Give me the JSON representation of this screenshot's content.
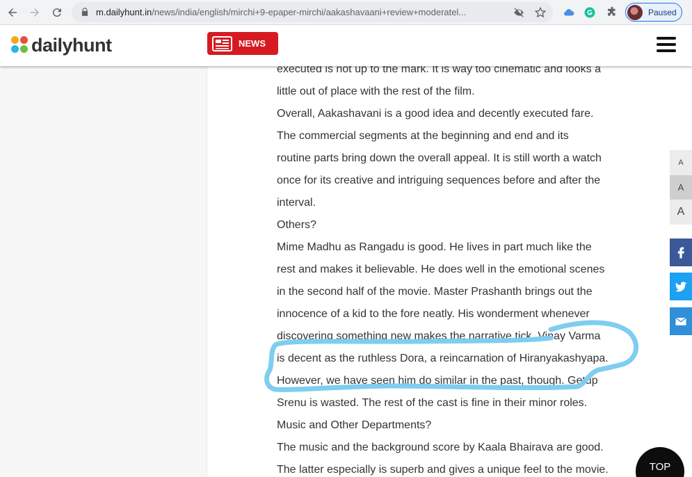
{
  "browser": {
    "url_host": "m.dailyhunt.in",
    "url_path": "/news/india/english/mirchi+9-epaper-mirchi/aakashavaani+review+moderatel...",
    "profile_label": "Paused"
  },
  "header": {
    "logo_text": "dailyhunt",
    "news_label": "NEWS"
  },
  "article": {
    "paragraphs": [
      "executed is not up to the mark. It is way too cinematic and looks a",
      "little out of place with the rest of the film.",
      "Overall, Aakashavani is a good idea and decently executed fare.",
      "The commercial segments at the beginning and end and its",
      "routine parts bring down the overall appeal. It is still worth a watch",
      "once for its creative and intriguing sequences before and after the",
      "interval.",
      "Others?",
      "Mime Madhu as Rangadu is good. He lives in part much like the",
      "rest and makes it believable. He does well in the emotional scenes",
      "in the second half of the movie. Master Prashanth brings out the",
      "innocence of a kid to the fore neatly. His wonderment whenever",
      "discovering something new makes the narrative tick. Vinay Varma",
      "is decent as the ruthless Dora, a reincarnation of Hiranyakashyapa.",
      "However, we have seen him do similar in the past, though. Getup",
      "Srenu is wasted. The rest of the cast is fine in their minor roles.",
      "Music and Other Departments?",
      "The music and the background score by Kaala Bhairava are good.",
      "The latter especially is superb and gives a unique feel to the movie."
    ]
  },
  "font_controls": {
    "small": "A",
    "medium": "A",
    "large": "A"
  },
  "top_button": "TOP",
  "colors": {
    "news_red": "#d71a21",
    "highlight_blue": "#7fcdf0",
    "facebook": "#3b5998",
    "twitter": "#1da1f2",
    "email": "#2f8fd8"
  }
}
